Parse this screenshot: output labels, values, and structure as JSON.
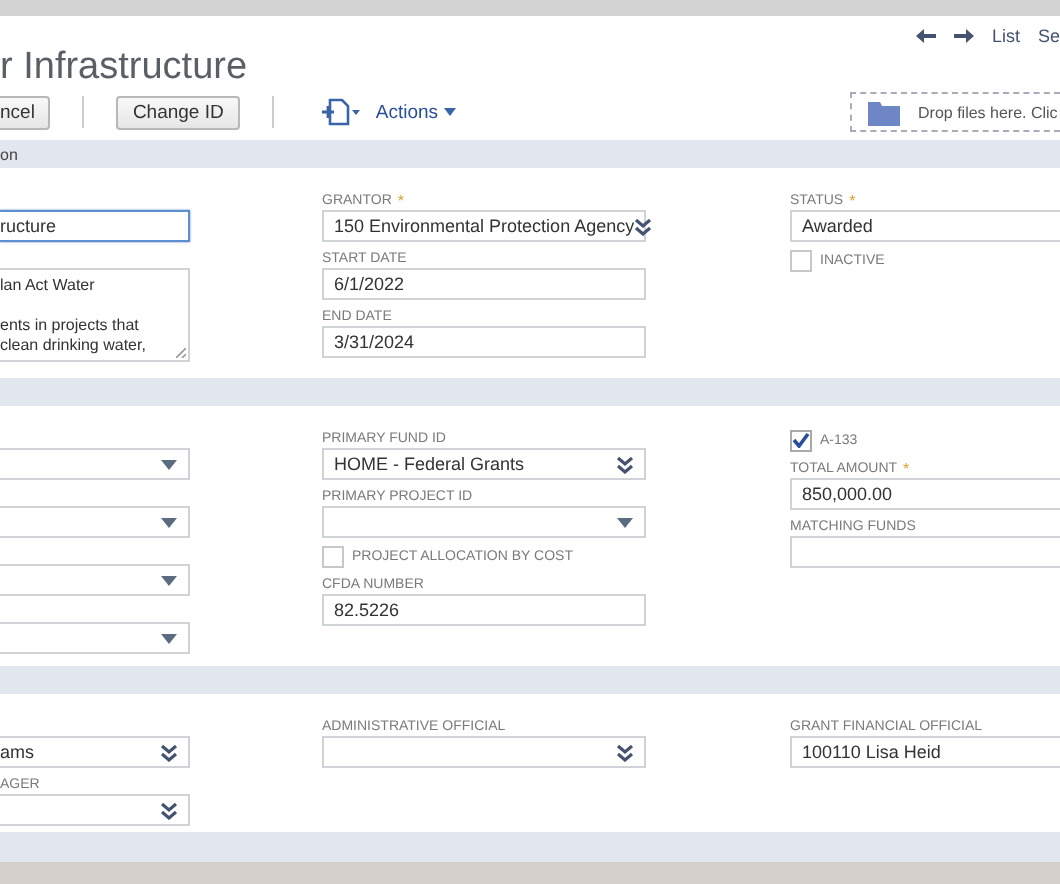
{
  "nav_links": [
    "List",
    "Se"
  ],
  "title": "r Infrastructure",
  "toolbar": {
    "buttons": [
      "ncel",
      "Change ID"
    ],
    "actions_menu": "Actions"
  },
  "drop_zone": "Drop files here. Clic",
  "sections": [
    {
      "title": "on",
      "columns": [
        [
          {
            "kind": "input",
            "value": "ructure",
            "focused": true
          },
          {
            "kind": "textarea",
            "value": "lan Act Water\n\nents in projects that\nclean drinking water,"
          }
        ],
        [
          {
            "kind": "select-double",
            "label": "GRANTOR",
            "required_mark": "*",
            "value": "150 Environmental Protection Agency"
          },
          {
            "kind": "input",
            "label": "START DATE",
            "value": "6/1/2022",
            "focused": false
          },
          {
            "kind": "input",
            "label": "END DATE",
            "value": "3/31/2024",
            "focused": false
          }
        ],
        [
          {
            "kind": "input",
            "label": "STATUS",
            "required_mark": "*",
            "value": "Awarded",
            "focused": false
          },
          {
            "kind": "checkbox",
            "label": "INACTIVE",
            "checked": false
          }
        ]
      ]
    },
    {
      "columns": [
        [
          {
            "kind": "select-single"
          },
          {
            "kind": "select-single"
          },
          {
            "kind": "select-single"
          },
          {
            "kind": "select-single"
          }
        ],
        [
          {
            "kind": "select-double",
            "label": "PRIMARY FUND ID",
            "value": "HOME - Federal Grants"
          },
          {
            "kind": "select-single",
            "label": "PRIMARY PROJECT ID"
          },
          {
            "kind": "checkbox",
            "label": "PROJECT ALLOCATION BY COST",
            "checked": false
          },
          {
            "kind": "input",
            "label": "CFDA NUMBER",
            "value": "82.5226",
            "focused": false
          }
        ],
        [
          {
            "kind": "checkbox",
            "label": "A-133",
            "checked": true
          },
          {
            "kind": "input",
            "label": "TOTAL AMOUNT",
            "required_mark": "*",
            "value": "850,000.00",
            "focused": false
          },
          {
            "kind": "input",
            "label": "MATCHING FUNDS",
            "focused": false
          }
        ]
      ]
    },
    {
      "columns": [
        [
          {
            "kind": "select-double",
            "value": "ams"
          },
          {
            "kind": "select-double",
            "label": "AGER"
          }
        ],
        [
          {
            "kind": "select-double",
            "label": "ADMINISTRATIVE OFFICIAL"
          }
        ],
        [
          {
            "kind": "input",
            "label": "GRANT FINANCIAL OFFICIAL",
            "value": "100110 Lisa Heid",
            "focused": false
          }
        ]
      ]
    }
  ]
}
